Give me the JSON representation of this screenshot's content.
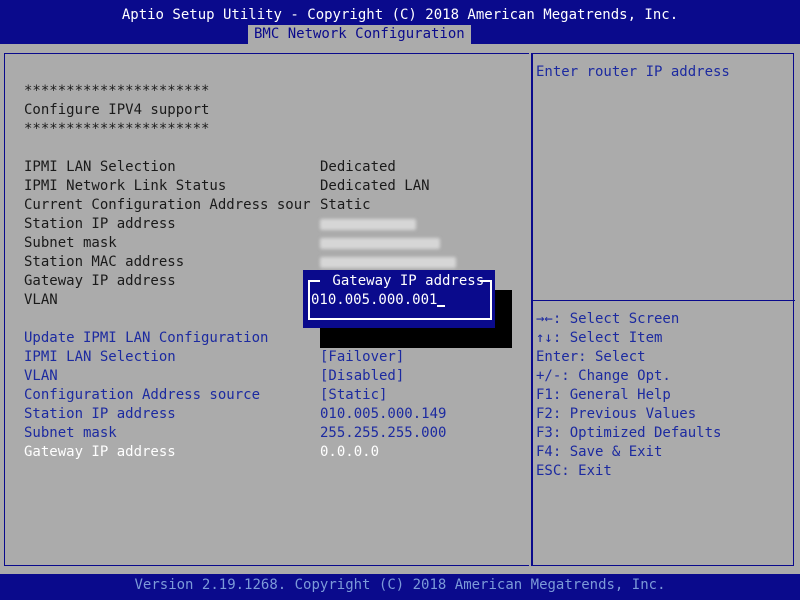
{
  "header": {
    "title": "Aptio Setup Utility - Copyright (C) 2018 American Megatrends, Inc.",
    "active_tab": "BMC Network Configuration"
  },
  "footer": {
    "text": "Version 2.19.1268. Copyright (C) 2018 American Megatrends, Inc."
  },
  "main": {
    "stars_1": "**********************",
    "section_title": "Configure IPV4 support",
    "stars_2": "**********************",
    "status_rows": [
      {
        "label": "IPMI LAN Selection",
        "value": "Dedicated"
      },
      {
        "label": "IPMI Network Link Status",
        "value": "Dedicated LAN"
      },
      {
        "label": "Current Configuration Address sour",
        "value": "Static"
      },
      {
        "label": "Station IP address",
        "value": ""
      },
      {
        "label": "Subnet mask",
        "value": ""
      },
      {
        "label": "Station MAC address",
        "value": ""
      },
      {
        "label": "Gateway IP address",
        "value": ""
      },
      {
        "label": "VLAN",
        "value": ""
      }
    ],
    "update_item": "Update IPMI LAN Configuration",
    "settings": [
      {
        "label": "IPMI LAN Selection",
        "value": "[Failover]"
      },
      {
        "label": "VLAN",
        "value": "[Disabled]"
      },
      {
        "label": "Configuration Address source",
        "value": "[Static]"
      },
      {
        "label": "Station IP address",
        "value": "010.005.000.149"
      },
      {
        "label": "Subnet mask",
        "value": "255.255.255.000"
      },
      {
        "label": "Gateway IP address",
        "value": "0.0.0.0"
      }
    ]
  },
  "popup": {
    "title": " Gateway IP address ",
    "value": "010.005.000.001"
  },
  "help": {
    "description": "Enter router IP address",
    "keys": [
      "→←: Select Screen",
      "↑↓: Select Item",
      "Enter: Select",
      "+/-: Change Opt.",
      "F1: General Help",
      "F2: Previous Values",
      "F3: Optimized Defaults",
      "F4: Save & Exit",
      "ESC: Exit"
    ]
  },
  "colors": {
    "bar": "#0a0a8c",
    "panel": "#ababab",
    "selectable": "#1c2aa0",
    "highlight": "#ffffff"
  }
}
